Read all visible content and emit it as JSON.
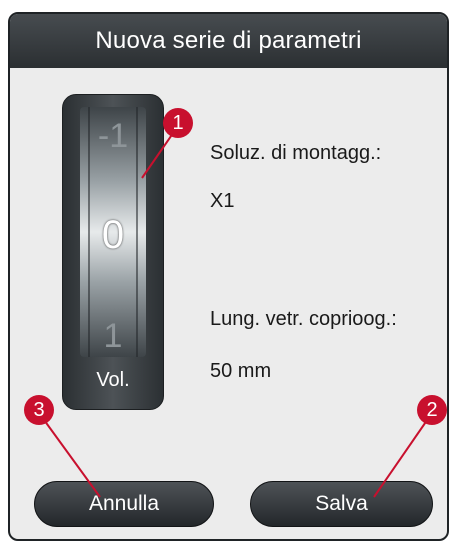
{
  "dialog": {
    "title": "Nuova serie di parametri"
  },
  "wheel": {
    "prev_value": "-1",
    "current_value": "0",
    "next_value": "1",
    "label": "Vol."
  },
  "info": {
    "mounting_label": "Soluz. di montagg.:",
    "mounting_value": "X1",
    "coverslip_label": "Lung. vetr. coprioog.:",
    "coverslip_value": "50 mm"
  },
  "buttons": {
    "cancel_label": "Annulla",
    "save_label": "Salva"
  },
  "callouts": [
    "1",
    "2",
    "3"
  ],
  "colors": {
    "callout": "#c8102e",
    "title_bar": "#3a3f42",
    "background": "#ececec"
  }
}
